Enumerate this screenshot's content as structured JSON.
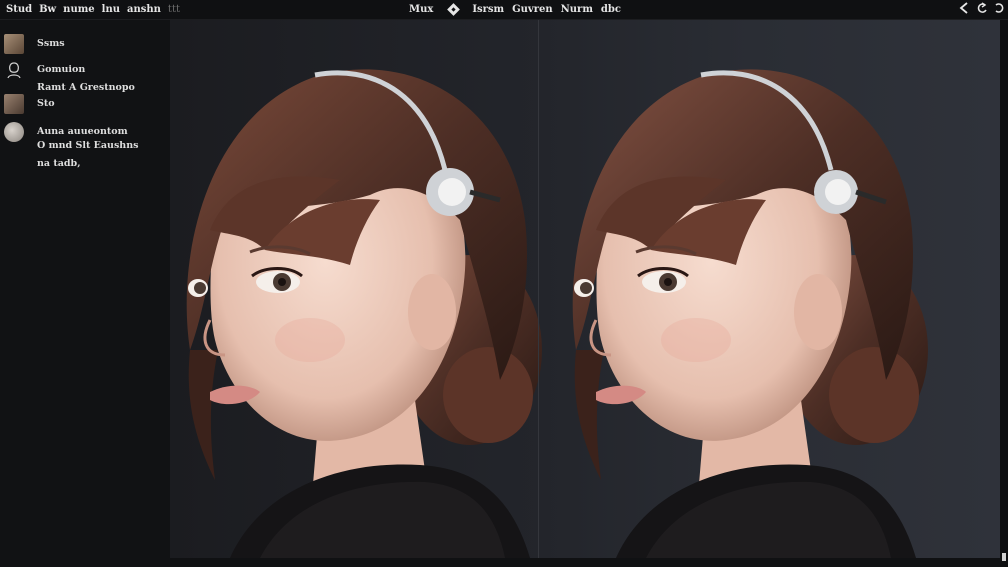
{
  "menu": {
    "left_items": [
      "Stud",
      "Bw",
      "nume",
      "lnu",
      "anshn"
    ],
    "left_dim": "ttt",
    "center_first": "Mux",
    "center_items": [
      "Isrsm",
      "Guvren",
      "Nurm",
      "dbc"
    ],
    "right_icons": [
      "cursor-back-icon",
      "undo-icon",
      "redo-icon"
    ]
  },
  "layers": [
    {
      "label": "Ssms",
      "thumb": "#8c7862"
    },
    {
      "label": "Gomuion",
      "thumb": "#3a3b3f"
    },
    {
      "label": "Ramt A Grestnopo",
      "thumb": null
    },
    {
      "label": "Sto",
      "thumb": "#6e5b4c"
    },
    {
      "label": "Auna auueontom",
      "thumb": "#b0aaa4"
    },
    {
      "label": "O mnd Slt Eaushns",
      "thumb": null
    },
    {
      "label": "na tadb,",
      "thumb": null
    }
  ],
  "colors": {
    "hair": "#4d2e25",
    "skin": "#f0d2c4",
    "headband": "#cfd2d6"
  }
}
